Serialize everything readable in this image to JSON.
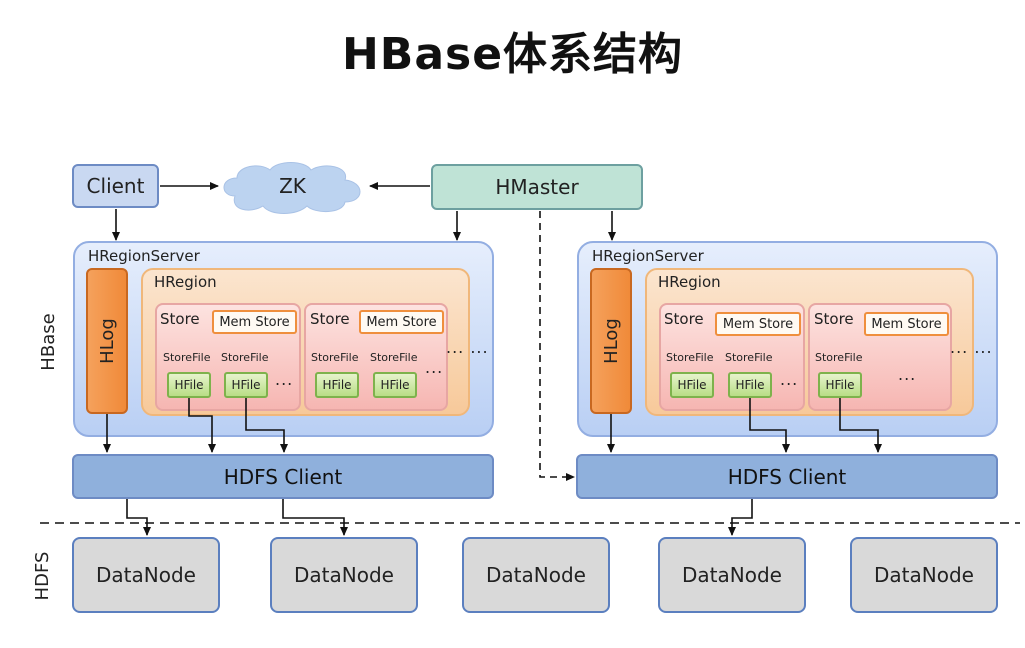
{
  "title": "HBase体系结构",
  "client": "Client",
  "zk": "ZK",
  "hmaster": "HMaster",
  "side_labels": {
    "hbase": "HBase",
    "hdfs": "HDFS"
  },
  "region_servers": [
    {
      "label": "HRegionServer",
      "hlog": "HLog",
      "region_label": "HRegion",
      "store_label": "Store",
      "memstore_label": "Mem Store",
      "storefile_label": "StoreFile",
      "hfile_label": "HFile",
      "ellipsis": "...",
      "outer_ellipsis": "... ..."
    },
    {
      "label": "HRegionServer",
      "hlog": "HLog",
      "region_label": "HRegion",
      "store_label": "Store",
      "memstore_label": "Mem Store",
      "storefile_label": "StoreFile",
      "hfile_label": "HFile",
      "ellipsis": "...",
      "outer_ellipsis": "... ..."
    }
  ],
  "hdfs_client": "HDFS Client",
  "datanodes": [
    "DataNode",
    "DataNode",
    "DataNode",
    "DataNode",
    "DataNode"
  ],
  "colors": {
    "hlog": "#f08a39",
    "hmaster": "#bfe3d6",
    "client": "#c9d8f1",
    "hdfs_client": "#8fb0dc",
    "datanode": "#d9d9d9",
    "hfile": "#b9de86"
  }
}
